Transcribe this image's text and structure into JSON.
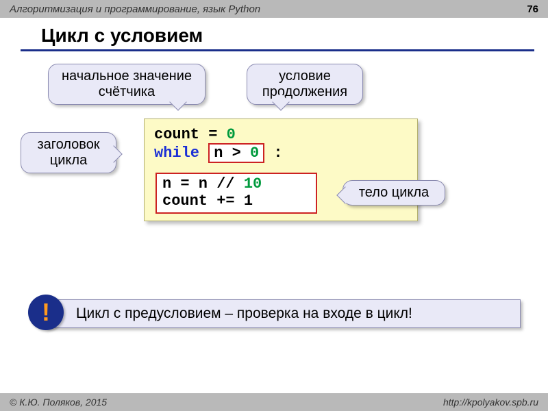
{
  "header": {
    "subject": "Алгоритмизация и программирование, язык Python",
    "page": "76"
  },
  "title": "Цикл с условием",
  "callouts": {
    "initial": "начальное значение счётчика",
    "condition": "условие продолжения",
    "head": "заголовок цикла",
    "body": "тело цикла"
  },
  "code": {
    "l1a": "count = ",
    "l1b": "0",
    "l2a": "while ",
    "l2b_n": "n > ",
    "l2b_z": "0",
    "l2c": " :",
    "l3a": "n = n // ",
    "l3b": "10",
    "l4": "count += 1"
  },
  "note": {
    "mark": "!",
    "text": " Цикл с предусловием – проверка на входе в цикл!"
  },
  "footer": {
    "left": "© К.Ю. Поляков, 2015",
    "right": "http://kpolyakov.spb.ru"
  }
}
